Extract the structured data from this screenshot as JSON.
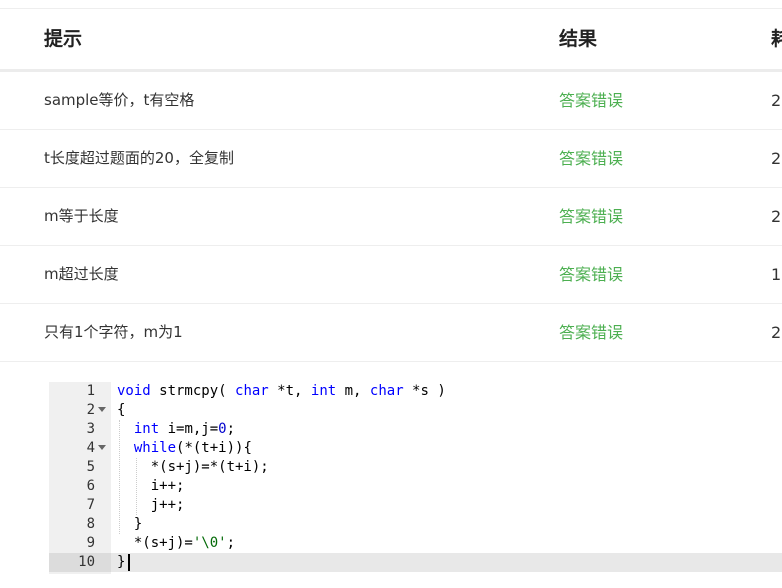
{
  "table": {
    "headers": {
      "hint": "提示",
      "result": "结果",
      "time": "耗"
    },
    "rows": [
      {
        "hint": "sample等价，t有空格",
        "result": "答案错误",
        "time": "2"
      },
      {
        "hint": "t长度超过题面的20，全复制",
        "result": "答案错误",
        "time": "2"
      },
      {
        "hint": "m等于长度",
        "result": "答案错误",
        "time": "2"
      },
      {
        "hint": "m超过长度",
        "result": "答案错误",
        "time": "1"
      },
      {
        "hint": "只有1个字符，m为1",
        "result": "答案错误",
        "time": "2"
      }
    ],
    "result_color": "#4caf50"
  },
  "editor": {
    "lines": [
      {
        "n": "1",
        "fold": false
      },
      {
        "n": "2",
        "fold": true
      },
      {
        "n": "3",
        "fold": false
      },
      {
        "n": "4",
        "fold": true
      },
      {
        "n": "5",
        "fold": false
      },
      {
        "n": "6",
        "fold": false
      },
      {
        "n": "7",
        "fold": false
      },
      {
        "n": "8",
        "fold": false
      },
      {
        "n": "9",
        "fold": false
      },
      {
        "n": "10",
        "fold": false
      }
    ],
    "active_line": "10",
    "keyword_color": "#0000ff",
    "string_color": "#036a07"
  }
}
